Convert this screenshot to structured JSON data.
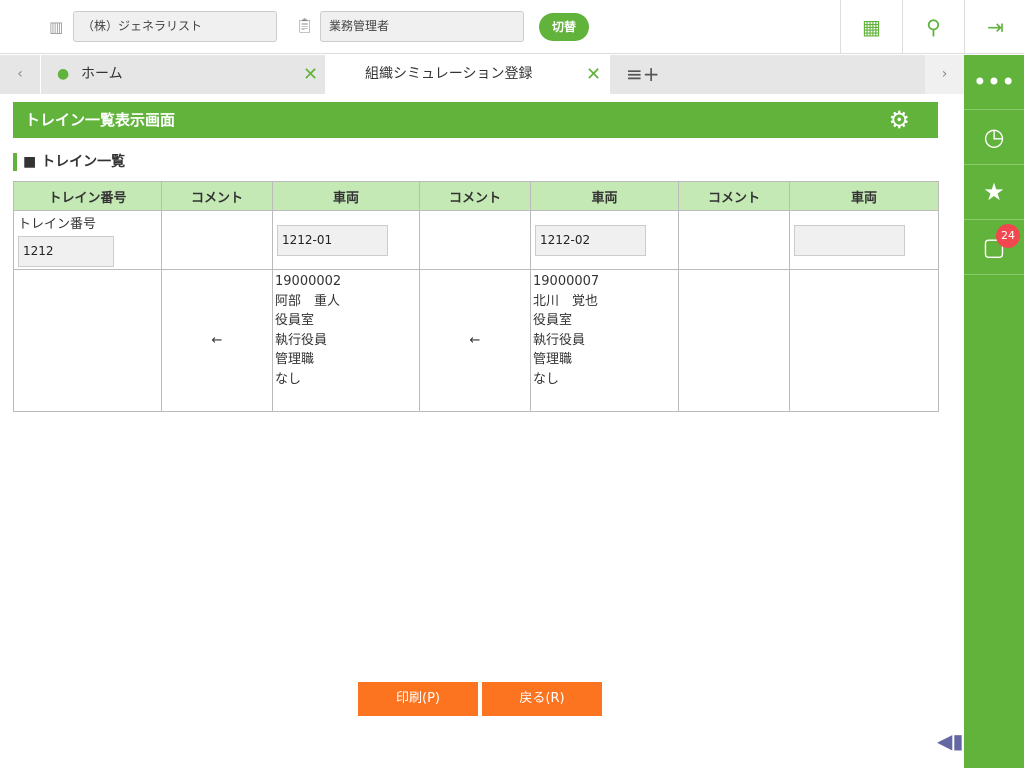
{
  "header": {
    "company": "（株）ジェネラリスト",
    "role": "業務管理者",
    "switch_label": "切替"
  },
  "tabs": [
    {
      "label": "ホーム"
    },
    {
      "label": "組織シミュレーション登録"
    }
  ],
  "page_title": "トレイン一覧表示画面",
  "section_title": "■ トレイン一覧",
  "table": {
    "headers": [
      "トレイン番号",
      "コメント",
      "車両",
      "コメント",
      "車両",
      "コメント",
      "車両"
    ],
    "train_label": "トレイン番号",
    "train_no": "1212",
    "cars": [
      "1212-01",
      "1212-02",
      ""
    ],
    "arrow": "←",
    "members": [
      [
        "19000002",
        "阿部　重人",
        "役員室",
        "執行役員",
        "管理職",
        "なし"
      ],
      [
        "19000007",
        "北川　覚也",
        "役員室",
        "執行役員",
        "管理職",
        "なし"
      ]
    ]
  },
  "sidebar": {
    "badge": "24"
  },
  "buttons": {
    "print": "印刷(P)",
    "back": "戻る(R)"
  }
}
